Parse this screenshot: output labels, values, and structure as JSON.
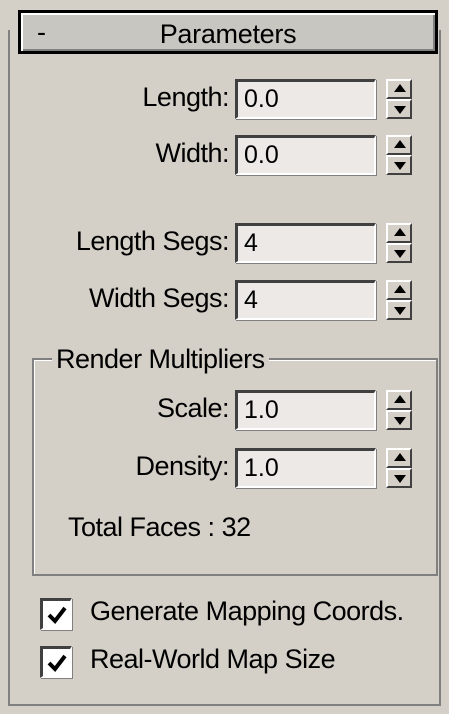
{
  "rollout": {
    "collapse_symbol": "-",
    "title": "Parameters"
  },
  "fields": {
    "length": {
      "label": "Length:",
      "value": "0.0"
    },
    "width": {
      "label": "Width:",
      "value": "0.0"
    },
    "length_segs": {
      "label": "Length Segs:",
      "value": "4"
    },
    "width_segs": {
      "label": "Width Segs:",
      "value": "4"
    }
  },
  "render_multipliers": {
    "title": "Render Multipliers",
    "scale": {
      "label": "Scale:",
      "value": "1.0"
    },
    "density": {
      "label": "Density:",
      "value": "1.0"
    },
    "total_faces": "Total Faces : 32"
  },
  "checkboxes": {
    "generate_mapping": {
      "label": "Generate Mapping Coords.",
      "checked": true
    },
    "real_world": {
      "label": "Real-World Map Size",
      "checked": true
    }
  },
  "icons": {
    "spinner_up": "triangle-up",
    "spinner_down": "triangle-down",
    "check": "checkmark"
  }
}
